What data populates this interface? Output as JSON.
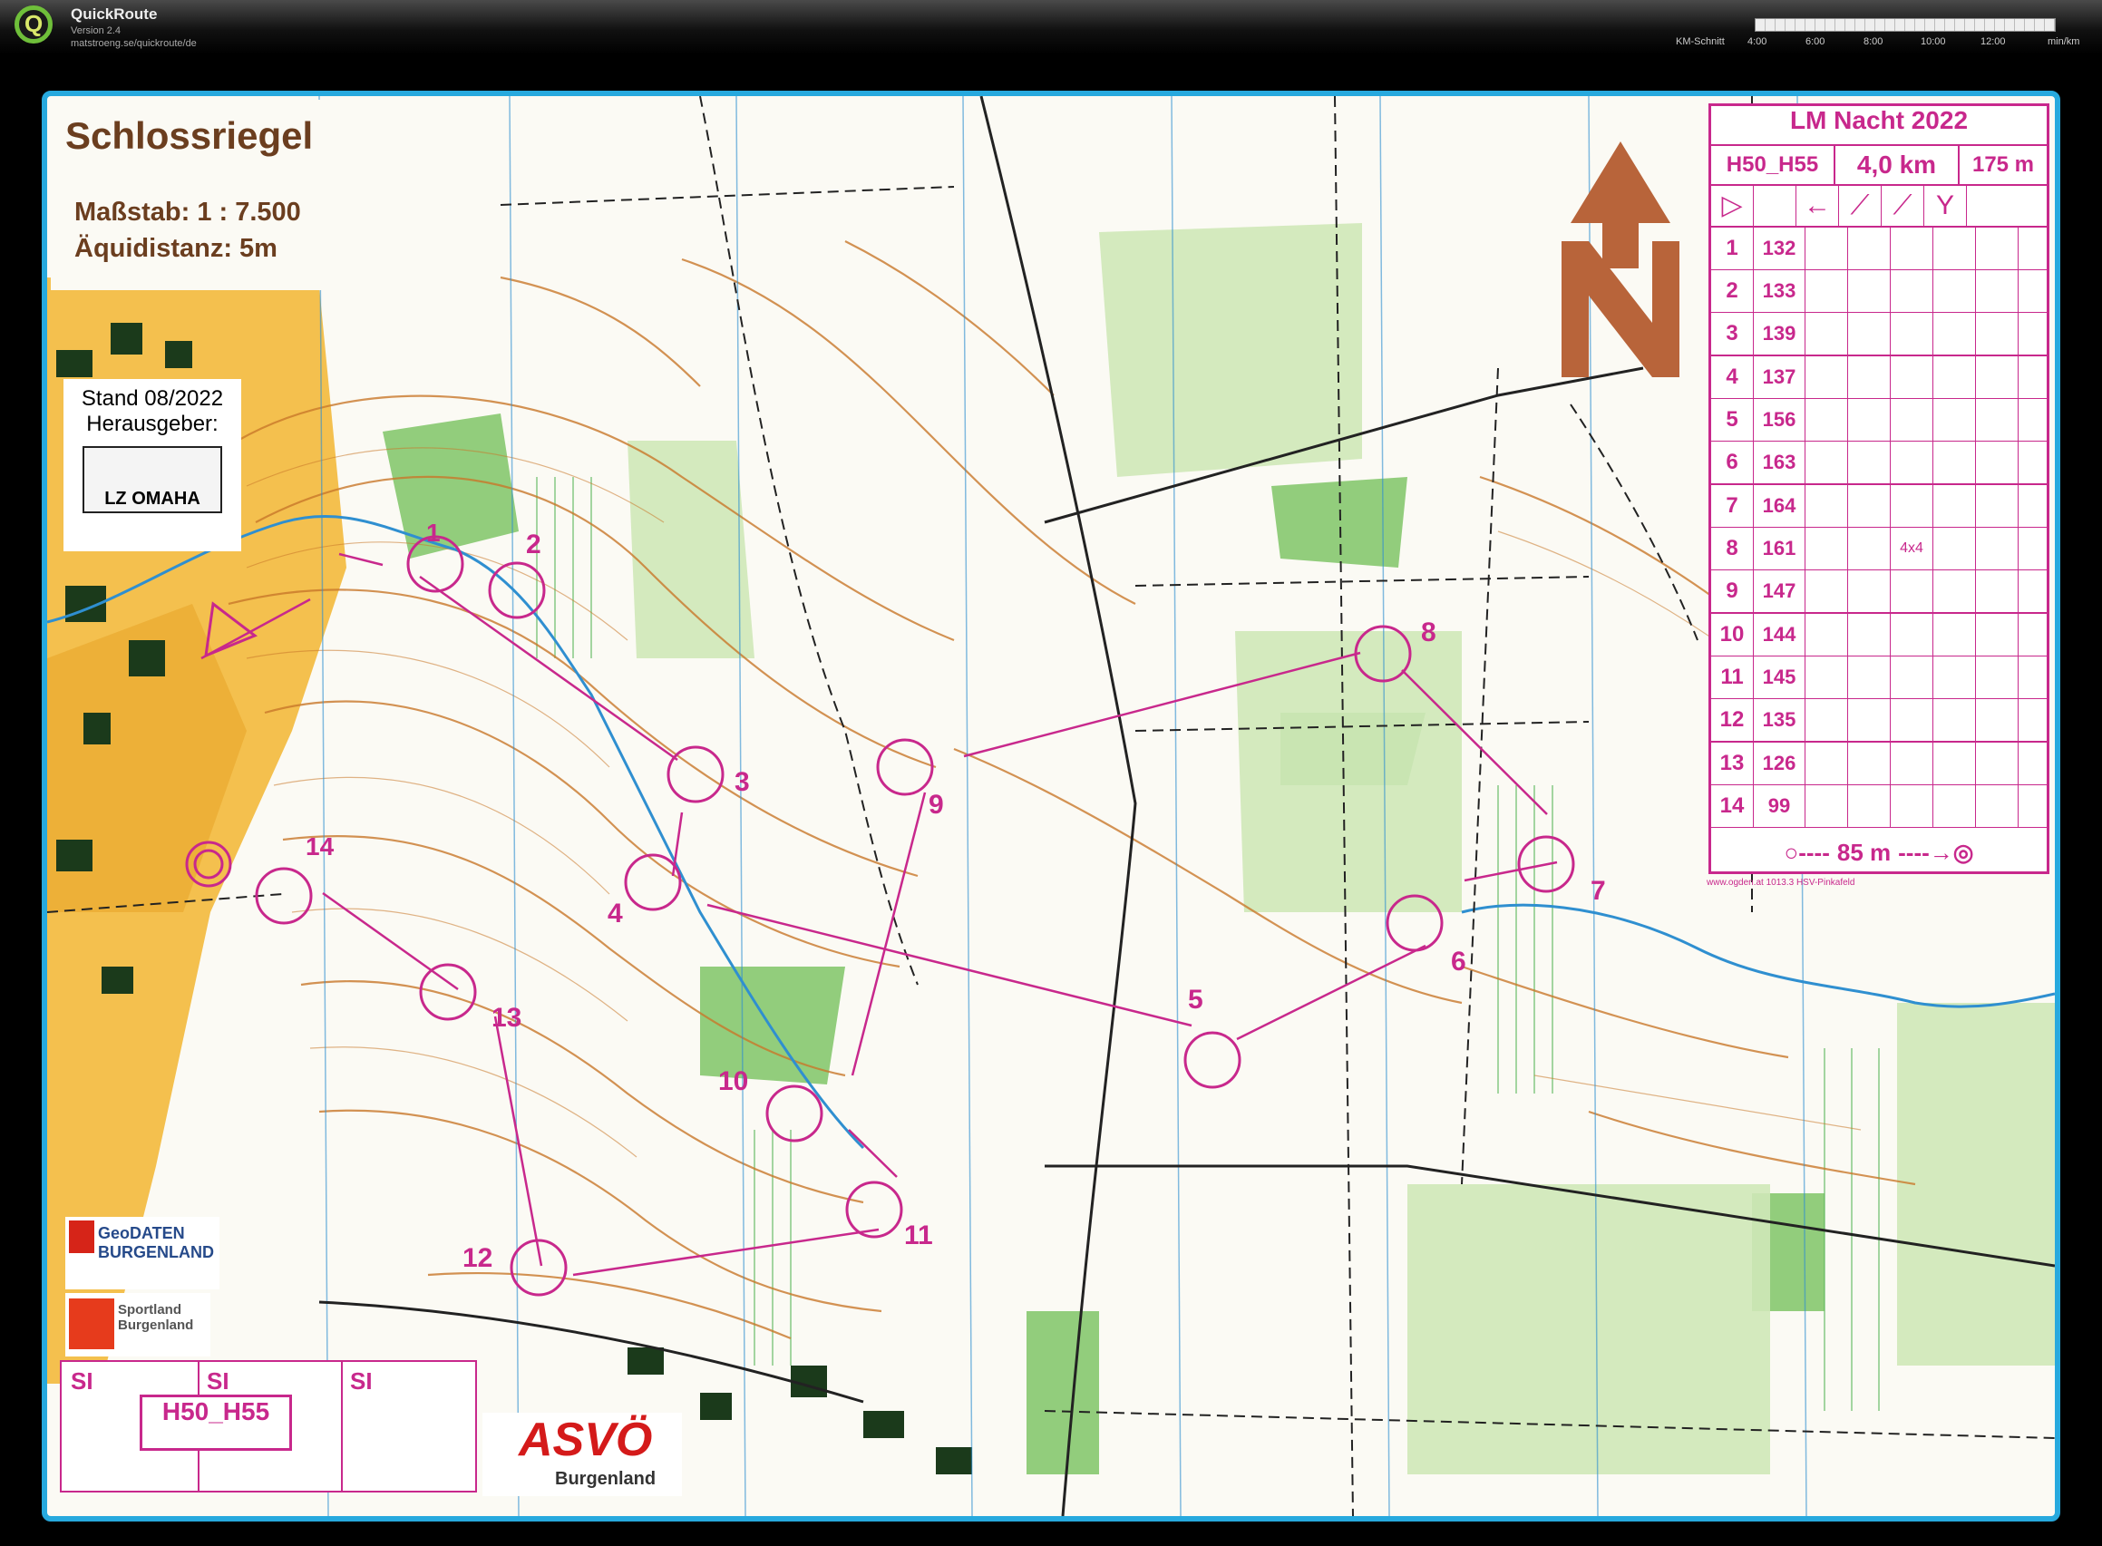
{
  "app": {
    "title": "QuickRoute",
    "version": "Version 2.4",
    "url": "matstroeng.se/quickroute/de",
    "km_label": "KM-Schnitt",
    "ticks": [
      "4:00",
      "6:00",
      "8:00",
      "10:00",
      "12:00",
      "min/km"
    ]
  },
  "map": {
    "name": "Schlossriegel",
    "scale": "Maßstab: 1 : 7.500",
    "equidistance": "Äquidistanz: 5m",
    "stand": "Stand 08/2022",
    "publisher": "Herausgeber:",
    "club_logo": "LZ OMAHA",
    "geodaten_logo": "GeoDATEN BURGENLAND",
    "sportland_logo": "Sportland Burgenland",
    "asvo_logo": "ASVÖ",
    "asvo_sub": "Burgenland",
    "si_labels": [
      "SI",
      "SI",
      "SI"
    ],
    "class_box": "H50_H55",
    "credit": "www.ogden.at 1013.3 HSV-Pinkafeld"
  },
  "controls": [
    {
      "num": "1"
    },
    {
      "num": "2"
    },
    {
      "num": "3"
    },
    {
      "num": "4"
    },
    {
      "num": "5"
    },
    {
      "num": "6"
    },
    {
      "num": "7"
    },
    {
      "num": "8"
    },
    {
      "num": "9"
    },
    {
      "num": "10"
    },
    {
      "num": "11"
    },
    {
      "num": "12"
    },
    {
      "num": "13"
    },
    {
      "num": "14"
    }
  ],
  "description": {
    "title": "LM Nacht 2022",
    "class": "H50_H55",
    "length": "4,0 km",
    "climb": "175 m",
    "rows": [
      {
        "n": "1",
        "code": "132"
      },
      {
        "n": "2",
        "code": "133"
      },
      {
        "n": "3",
        "code": "139"
      },
      {
        "n": "4",
        "code": "137"
      },
      {
        "n": "5",
        "code": "156"
      },
      {
        "n": "6",
        "code": "163"
      },
      {
        "n": "7",
        "code": "164"
      },
      {
        "n": "8",
        "code": "161",
        "extra": "4x4"
      },
      {
        "n": "9",
        "code": "147"
      },
      {
        "n": "10",
        "code": "144"
      },
      {
        "n": "11",
        "code": "145"
      },
      {
        "n": "12",
        "code": "135"
      },
      {
        "n": "13",
        "code": "126"
      },
      {
        "n": "14",
        "code": "99"
      }
    ],
    "finish": "85 m"
  },
  "colors": {
    "course": "#c8288c",
    "frame": "#27a9de",
    "contour": "#c9782a",
    "forest": "#7fc466",
    "yellow": "#f2b530"
  }
}
